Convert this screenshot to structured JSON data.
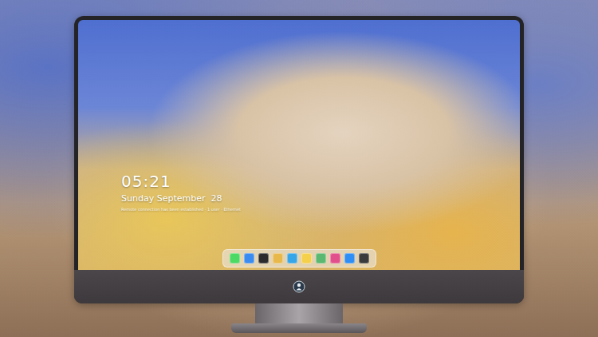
{
  "lock_screen": {
    "time": "05:21",
    "date": "Sunday September  28",
    "status": "Remote connection has been established · 1 user · Ethernet"
  },
  "dock": {
    "items": [
      {
        "color": "#4cd964"
      },
      {
        "color": "#3b8cf0"
      },
      {
        "color": "#2c2c2e"
      },
      {
        "color": "#e8b84a"
      },
      {
        "color": "#36a6e8"
      },
      {
        "color": "#f5d04a"
      },
      {
        "color": "#5ab870"
      },
      {
        "color": "#e2508c"
      },
      {
        "color": "#2f8ef5"
      },
      {
        "color": "#3a3a3c"
      }
    ]
  }
}
